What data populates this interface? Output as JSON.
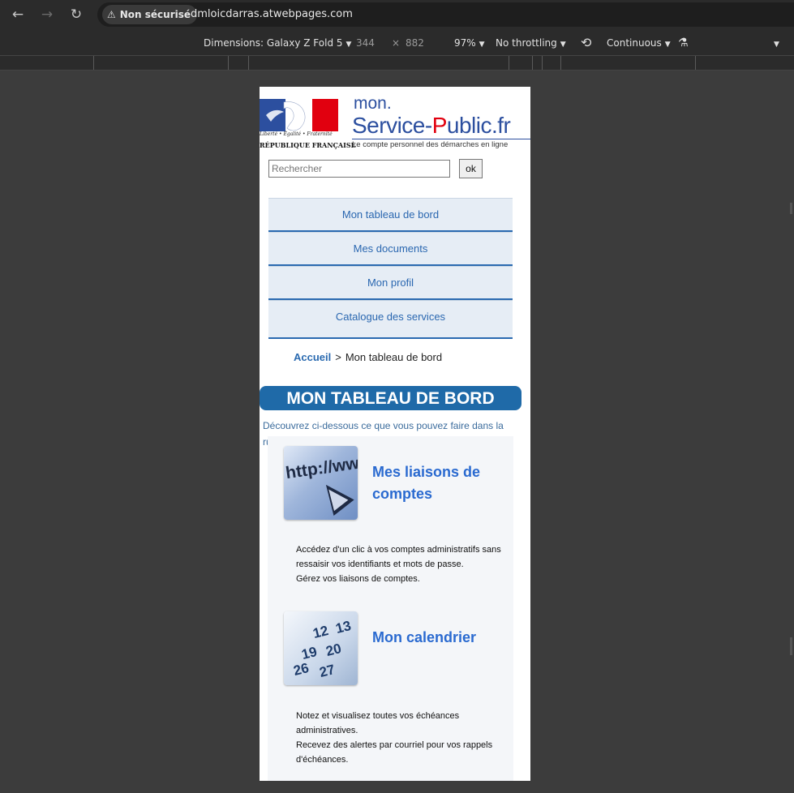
{
  "browser": {
    "security_label": "Non sécurisé",
    "url": "dmloicdarras.atwebpages.com"
  },
  "devtools": {
    "dimensions_label": "Dimensions: Galaxy Z Fold 5",
    "width": "344",
    "times": "×",
    "height": "882",
    "zoom": "97%",
    "throttling": "No throttling",
    "mode": "Continuous"
  },
  "site": {
    "logo": {
      "motto": "Liberté • Égalité • Fraternité",
      "republic": "RÉPUBLIQUE FRANÇAISE"
    },
    "brand": {
      "mon": "mon.",
      "service": "Service-",
      "p": "P",
      "ublic": "ublic.fr",
      "tagline": "Le compte personnel des démarches en ligne"
    },
    "search": {
      "placeholder": "Rechercher",
      "button": "ok"
    },
    "menu": [
      "Mon tableau de bord",
      "Mes documents",
      "Mon profil",
      "Catalogue des services"
    ],
    "breadcrumb": {
      "home": "Accueil",
      "separator": ">",
      "current": "Mon tableau de bord"
    },
    "page_title": "MON TABLEAU DE BORD",
    "intro": "Découvrez ci-dessous ce que vous pouvez faire dans la rubrique",
    "cards": [
      {
        "title": "Mes liaisons de comptes",
        "lines": [
          "Accédez d'un clic à vos comptes administratifs sans ressaisir vos identifiants et mots de passe.",
          "Gérez vos liaisons de comptes."
        ],
        "thumb_text": "http://ww"
      },
      {
        "title": "Mon calendrier",
        "lines": [
          "Notez et visualisez toutes vos échéances administratives.",
          "Recevez des alertes par courriel pour vos rappels d'échéances."
        ],
        "thumb_numbers": [
          "12",
          "13",
          "19",
          "20",
          "26",
          "27"
        ]
      }
    ]
  }
}
